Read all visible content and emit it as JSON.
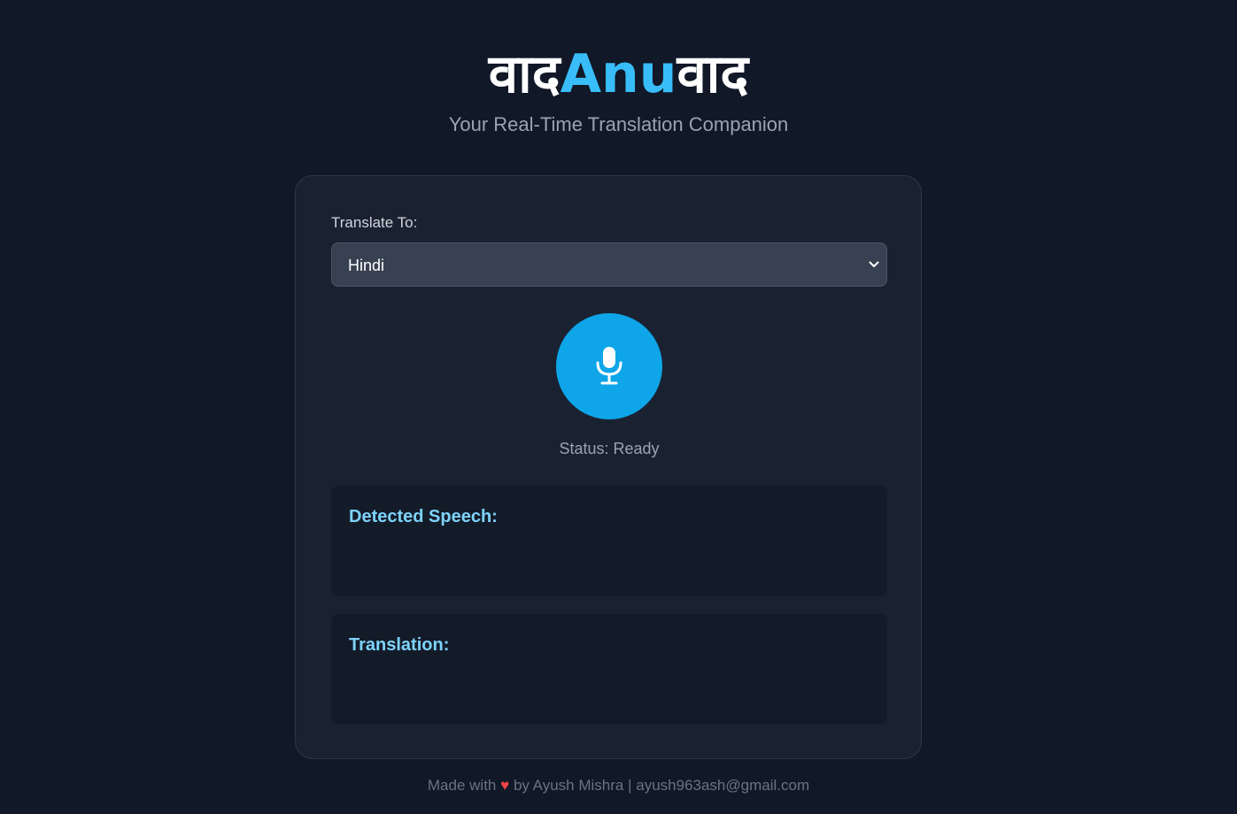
{
  "header": {
    "title_part1": "वाद",
    "title_part2": "Anu",
    "title_part3": "वाद",
    "subtitle": "Your Real-Time Translation Companion"
  },
  "form": {
    "label": "Translate To:",
    "selected_language": "Hindi"
  },
  "mic": {
    "icon": "microphone-icon",
    "status": "Status: Ready"
  },
  "panels": {
    "detected_heading": "Detected Speech:",
    "detected_text": "",
    "translation_heading": "Translation:",
    "translation_text": ""
  },
  "footer": {
    "made_with": "Made with",
    "heart": "♥",
    "by": "by Ayush Mishra",
    "separator": "|",
    "email": "ayush963ash@gmail.com"
  },
  "colors": {
    "background": "#111827",
    "card": "#1a2232",
    "accent": "#38bdf8",
    "mic_button": "#0ea5e9",
    "panel_heading": "#7dd3fc",
    "heart": "#ef4444"
  }
}
